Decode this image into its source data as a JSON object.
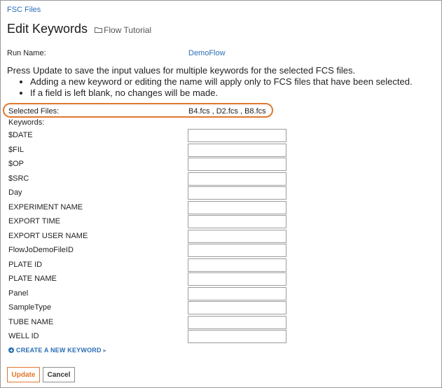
{
  "breadcrumb": {
    "label": "FSC Files"
  },
  "header": {
    "title": "Edit Keywords",
    "folder_label": "Flow Tutorial"
  },
  "run": {
    "label": "Run Name:",
    "value": "DemoFlow"
  },
  "instructions": {
    "intro": "Press Update to save the input values for multiple keywords for the selected FCS files.",
    "bullets": [
      "Adding a new keyword or editing the name will apply only to FCS files that have been selected.",
      "If a field is left blank, no changes will be made."
    ]
  },
  "selected_files": {
    "label": "Selected Files:",
    "value": "B4.fcs , D2.fcs , B8.fcs",
    "highlight_color": "#e0772f"
  },
  "keywords": {
    "heading": "Keywords:",
    "rows": [
      {
        "name": "$DATE",
        "value": ""
      },
      {
        "name": "$FIL",
        "value": ""
      },
      {
        "name": "$OP",
        "value": ""
      },
      {
        "name": "$SRC",
        "value": ""
      },
      {
        "name": "Day",
        "value": ""
      },
      {
        "name": "EXPERIMENT NAME",
        "value": ""
      },
      {
        "name": "EXPORT TIME",
        "value": ""
      },
      {
        "name": "EXPORT USER NAME",
        "value": ""
      },
      {
        "name": "FlowJoDemoFileID",
        "value": ""
      },
      {
        "name": "PLATE ID",
        "value": ""
      },
      {
        "name": "PLATE NAME",
        "value": ""
      },
      {
        "name": "Panel",
        "value": ""
      },
      {
        "name": "SampleType",
        "value": ""
      },
      {
        "name": "TUBE NAME",
        "value": ""
      },
      {
        "name": "WELL ID",
        "value": ""
      }
    ]
  },
  "create_keyword": {
    "label": "CREATE A NEW KEYWORD"
  },
  "buttons": {
    "update": "Update",
    "cancel": "Cancel"
  },
  "icons": {
    "folder": "folder-icon",
    "plus": "plus-circle-icon",
    "caret": "caret-right-icon"
  },
  "colors": {
    "link": "#2a6eb5",
    "accent": "#e0772f"
  }
}
